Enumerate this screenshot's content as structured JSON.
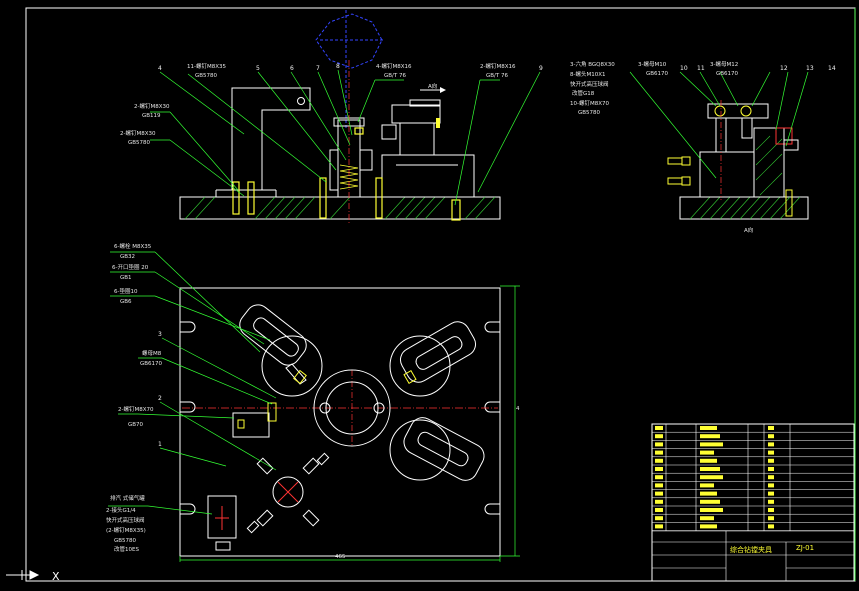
{
  "colors": {
    "background": "#000000",
    "outline": "#ffffff",
    "leader": "#33ff33",
    "center": "#ff3333",
    "hidden": "#3344ff",
    "hatch": "#33cc33",
    "text": "#ffff33",
    "bolt": "#ffff33"
  },
  "icons": {
    "cursor": "ucs-crosshair-icon"
  },
  "front_view": {
    "labels": [
      {
        "id": "l1",
        "text": "2-螺钉M8X30"
      },
      {
        "id": "l1b",
        "text": "GB119"
      },
      {
        "id": "l2",
        "text": "2-螺钉M8X30"
      },
      {
        "id": "l2b",
        "text": "GB5780"
      },
      {
        "id": "l3",
        "text": "11-螺钉M8X35"
      },
      {
        "id": "l3b",
        "text": "GB5780"
      },
      {
        "id": "l4",
        "text": "4-螺钉M8X16"
      },
      {
        "id": "l4b",
        "text": "GB/T 76"
      },
      {
        "id": "l5",
        "text": "2-螺钉M8X16"
      },
      {
        "id": "l5b",
        "text": "GB/T 76"
      }
    ],
    "numbers": [
      "4",
      "5",
      "6",
      "7",
      "8",
      "9"
    ],
    "section_mark": "A向"
  },
  "side_view": {
    "labels": [
      {
        "id": "s1",
        "text": "3-六角  BGQ8X30"
      },
      {
        "id": "s2",
        "text": "8-螺头M10X1"
      },
      {
        "id": "s3",
        "text": "快开式高压球阀"
      },
      {
        "id": "s4",
        "text": "改管G18"
      },
      {
        "id": "s5",
        "text": "10-螺钉M8X70"
      },
      {
        "id": "s5b",
        "text": "GB5780"
      },
      {
        "id": "s6",
        "text": "3-螺母M10"
      },
      {
        "id": "s6b",
        "text": "GB6170"
      },
      {
        "id": "s7",
        "text": "3-螺母M12"
      },
      {
        "id": "s7b",
        "text": "GB6170"
      }
    ],
    "numbers": [
      "10",
      "11",
      "12",
      "13",
      "14"
    ],
    "view_label": "A向"
  },
  "plan_view": {
    "labels": [
      {
        "id": "p1",
        "text": "6-螺栓 M8X35"
      },
      {
        "id": "p1b",
        "text": "GB32"
      },
      {
        "id": "p2",
        "text": "6-开口垫圈 20"
      },
      {
        "id": "p2b",
        "text": "GB1"
      },
      {
        "id": "p3",
        "text": "6-垫圈10"
      },
      {
        "id": "p3b",
        "text": "GB6"
      },
      {
        "id": "p4",
        "text": "螺母M8"
      },
      {
        "id": "p4b",
        "text": "GB6170"
      },
      {
        "id": "p5",
        "text": "2-螺钉M8X70"
      },
      {
        "id": "p5b",
        "text": "GB70"
      },
      {
        "id": "p6",
        "text": "排汽 式储气罐"
      },
      {
        "id": "p7",
        "text": "2-接头G1/4"
      },
      {
        "id": "p8",
        "text": "快开式高压球阀"
      },
      {
        "id": "p9",
        "text": "(2-螺钉M8X35)"
      },
      {
        "id": "p10",
        "text": "GB5780"
      },
      {
        "id": "p11",
        "text": "改管10ES"
      }
    ],
    "numbers": [
      "1",
      "2",
      "3"
    ],
    "dims": {
      "width": "465",
      "height": "4"
    }
  },
  "title_block": {
    "part_name": "综合钻镗夹具",
    "drawing_no": "ZJ-01"
  },
  "cursor_label": "X"
}
